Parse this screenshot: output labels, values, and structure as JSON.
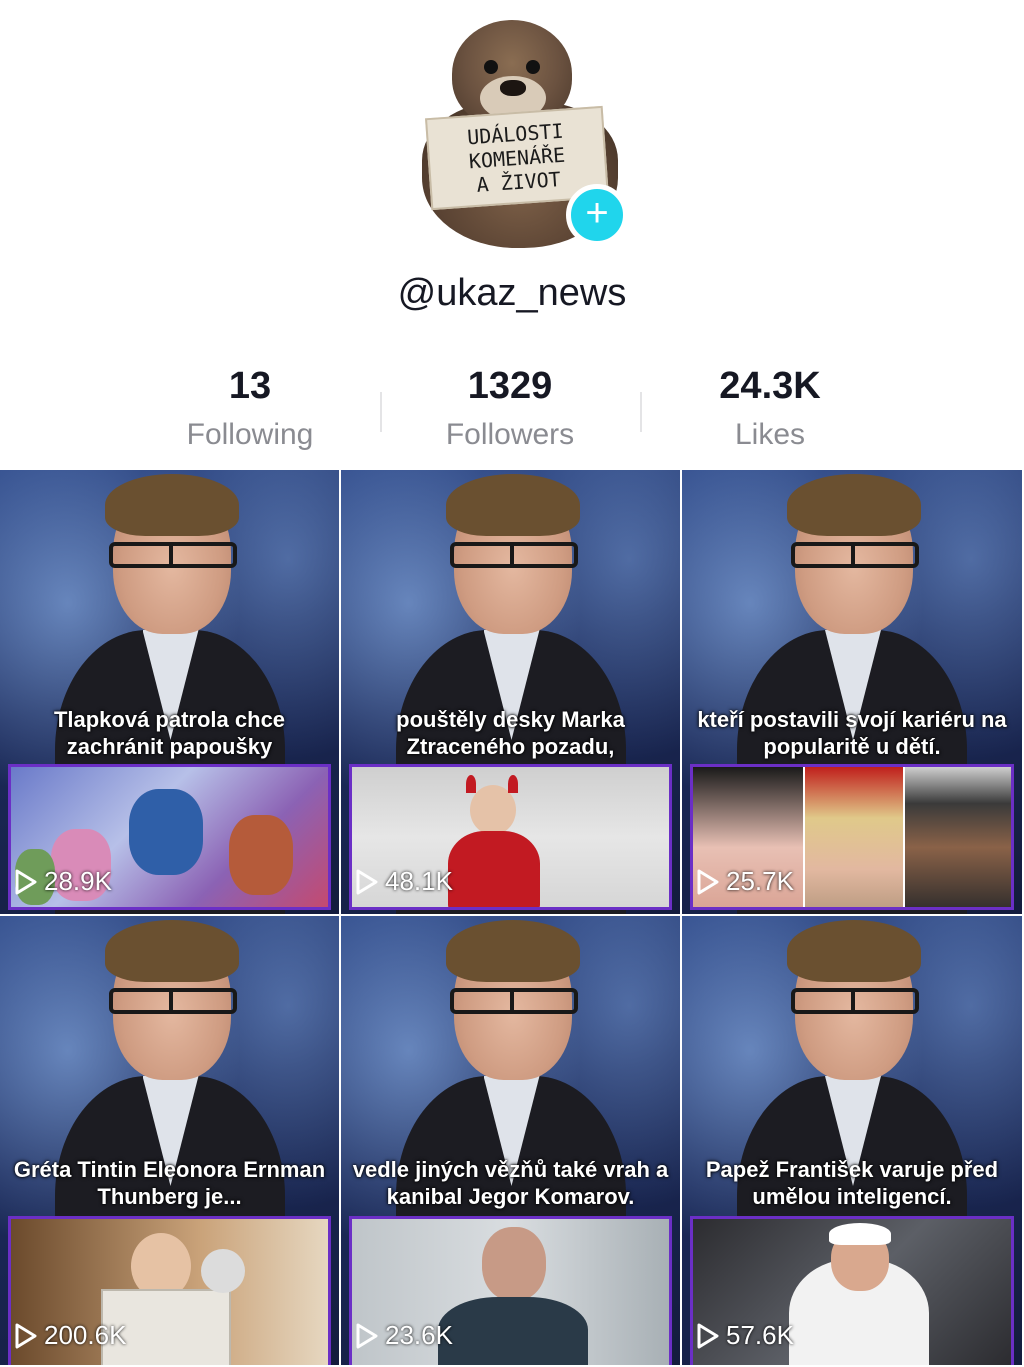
{
  "profile": {
    "avatar_sign_lines": [
      "UDÁLOSTI",
      "KOMENÁŘE",
      "A ŽIVOT"
    ],
    "username": "@ukaz_news",
    "follow_plus": "+"
  },
  "stats": [
    {
      "value": "13",
      "label": "Following"
    },
    {
      "value": "1329",
      "label": "Followers"
    },
    {
      "value": "24.3K",
      "label": "Likes"
    }
  ],
  "videos": [
    {
      "caption": "Tlapková patrola chce zachránit papoušky",
      "views": "28.9K"
    },
    {
      "caption": "pouštěly desky Marka Ztraceného pozadu,",
      "views": "48.1K"
    },
    {
      "caption": "kteří postavili svojí kariéru na popularitě u dětí.",
      "views": "25.7K"
    },
    {
      "caption": "Gréta Tintin Eleonora Ernman Thunberg je...",
      "views": "200.6K"
    },
    {
      "caption": "vedle jiných vězňů také vrah a kanibal Jegor Komarov.",
      "views": "23.6K"
    },
    {
      "caption": "Papež František varuje před umělou inteligencí.",
      "views": "57.6K"
    }
  ],
  "colors": {
    "accent_plus": "#20d5ec",
    "inset_border": "#6b2fc6",
    "label_grey": "#8a8b91"
  },
  "icons": [
    "plus-icon",
    "play-icon"
  ]
}
